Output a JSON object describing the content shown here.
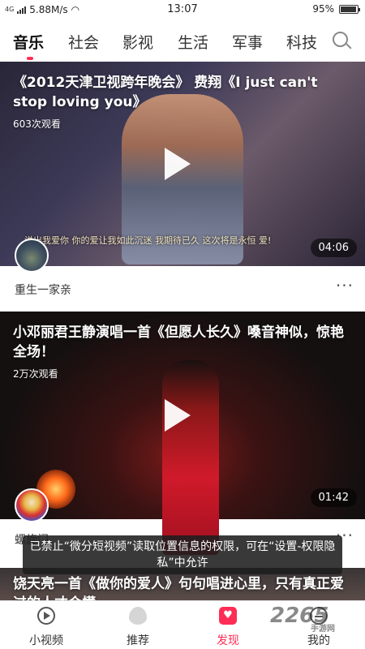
{
  "status": {
    "network": "4G",
    "speed": "5.88M/s",
    "time": "13:07",
    "battery_text": "95%",
    "battery_level": 0.95
  },
  "tabs": [
    "音乐",
    "社会",
    "影视",
    "生活",
    "军事",
    "科技"
  ],
  "active_tab": "音乐",
  "feed": [
    {
      "title": "《2012天津卫视跨年晚会》 费翔《I just can't stop loving you》",
      "views": "603次观看",
      "duration": "04:06",
      "author": "重生一家亲",
      "subtitle": "说出我爱你 你的爱让我如此沉迷 我期待已久 这次将是永恒 爱!"
    },
    {
      "title": "小邓丽君王静演唱一首《但愿人长久》嗓音神似，惊艳全场！",
      "views": "2万次观看",
      "duration": "01:42",
      "author": "螺旋门"
    },
    {
      "title": "饶天亮一首《做你的爱人》句句唱进心里，只有真正爱过的人才会懂"
    }
  ],
  "toast": "已禁止“微分短视频”读取位置信息的权限，可在“设置-权限隐私”中允许",
  "bottom_nav": [
    "小视频",
    "推荐",
    "发现",
    "我的"
  ],
  "active_nav": "发现",
  "watermark": {
    "text": "2265",
    "sub": "手游网"
  },
  "accent_color": "#ff2d55"
}
